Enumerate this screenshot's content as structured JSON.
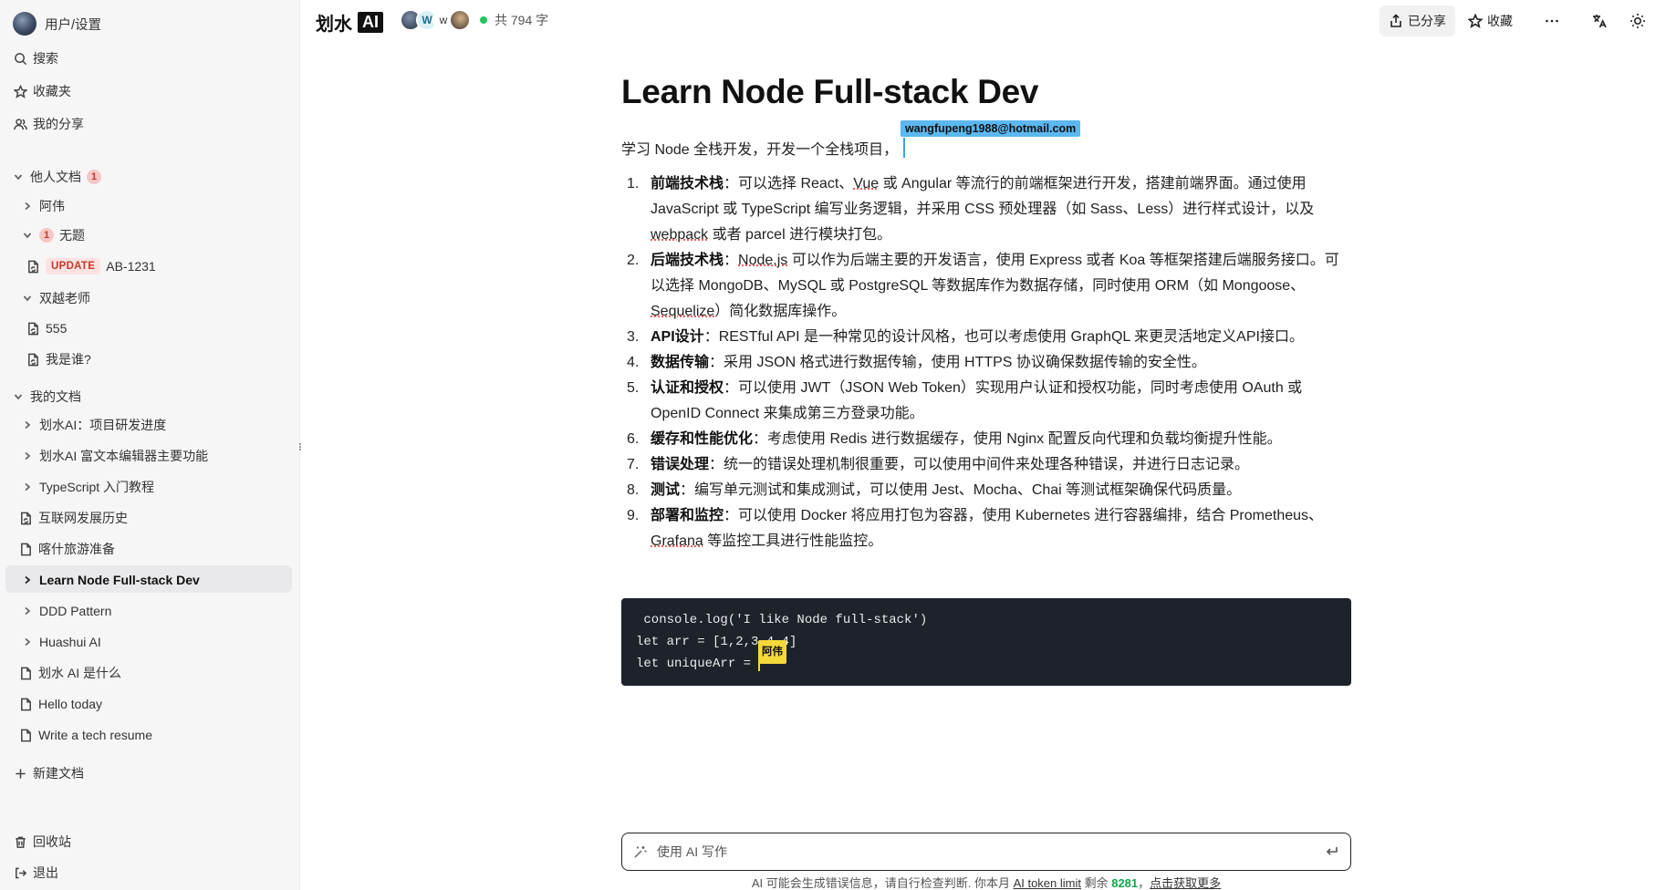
{
  "sidebar": {
    "user_label": "用户/设置",
    "search": "搜索",
    "favorites": "收藏夹",
    "my_shares": "我的分享",
    "others_docs": {
      "title": "他人文档",
      "badge": "1"
    },
    "others_items": {
      "awei": "阿伟",
      "untitled": {
        "badge": "1",
        "label": "无题"
      },
      "update_doc": {
        "tag": "UPDATE",
        "label": "AB-1231"
      },
      "teacher": "双越老师",
      "doc555": "555",
      "whoami": "我是谁?"
    },
    "my_docs": {
      "title": "我的文档"
    },
    "my_items": {
      "i1": "划水AI：项目研发进度",
      "i2": "划水AI 富文本编辑器主要功能",
      "i3": "TypeScript 入门教程",
      "i4": "互联网发展历史",
      "i5": "喀什旅游准备",
      "i6": "Learn Node Full-stack Dev",
      "i7": "DDD Pattern",
      "i8": "Huashui AI",
      "i9": "划水 AI 是什么",
      "i10": "Hello today",
      "i11": "Write a tech resume"
    },
    "new_doc": "新建文档",
    "trash": "回收站",
    "logout": "退出"
  },
  "header": {
    "brand": "划水",
    "brand_ai": "AI",
    "collab_letter_a2": "W",
    "collab_letter_a3": "w",
    "word_count": "共 794 字",
    "shared_label": "已分享",
    "favorite_label": "收藏"
  },
  "doc": {
    "title": "Learn Node Full-stack Dev",
    "intro": "学习 Node 全栈开发，开发一个全栈项目，",
    "cursor_user": "wangfupeng1988@hotmail.com",
    "items": {
      "n1": "1.",
      "n2": "2.",
      "n3": "3.",
      "n4": "4.",
      "n5": "5.",
      "n6": "6.",
      "n7": "7.",
      "n8": "8.",
      "n9": "9.",
      "b1": "前端技术栈",
      "t1a": "：可以选择 React、",
      "t1b": "Vue",
      "t1c": " 或 Angular 等流行的前端框架进行开发，搭建前端界面。通过使用 JavaScript 或 TypeScript 编写业务逻辑，并采用 CSS 预处理器（如 Sass、Less）进行样式设计，以及 ",
      "t1d": "webpack",
      "t1e": " 或者 parcel 进行模块打包。",
      "b2": "后端技术栈",
      "t2a": "：",
      "t2b": "Node.js",
      "t2c": " 可以作为后端主要的开发语言，使用 Express 或者 Koa 等框架搭建后端服务接口。可以选择 MongoDB、MySQL 或 PostgreSQL 等数据库作为数据存储，同时使用 ORM（如 Mongoose、",
      "t2d": "Sequelize",
      "t2e": "）简化数据库操作。",
      "b3": "API设计",
      "t3": "：RESTful API 是一种常见的设计风格，也可以考虑使用 GraphQL 来更灵活地定义API接口。",
      "b4": "数据传输",
      "t4": "：采用 JSON 格式进行数据传输，使用 HTTPS 协议确保数据传输的安全性。",
      "b5": "认证和授权",
      "t5": "：可以使用 JWT（JSON Web Token）实现用户认证和授权功能，同时考虑使用 OAuth 或 OpenID Connect 来集成第三方登录功能。",
      "b6": "缓存和性能优化",
      "t6": "：考虑使用 Redis 进行数据缓存，使用 Nginx 配置反向代理和负载均衡提升性能。",
      "b7": "错误处理",
      "t7": "：统一的错误处理机制很重要，可以使用中间件来处理各种错误，并进行日志记录。",
      "b8": "测试",
      "t8": "：编写单元测试和集成测试，可以使用 Jest、Mocha、Chai 等测试框架确保代码质量。",
      "b9": "部署和监控",
      "t9a": "：可以使用 Docker 将应用打包为容器，使用 Kubernetes 进行容器编排，结合 Prometheus、",
      "t9b": "Grafana",
      "t9c": " 等监控工具进行性能监控。"
    },
    "code": {
      "line1": " console.log('I like Node full-stack')",
      "line2": "let arr = [1,2,3,4,4]",
      "line3": "let uniqueArr = ",
      "cursor_user": "阿伟"
    }
  },
  "ai": {
    "placeholder": "使用 AI 写作",
    "note_prefix": "AI 可能会生成错误信息，请自行检查判断. 你本月 ",
    "note_link": "AI token limit",
    "note_mid": " 剩余 ",
    "note_remaining": "8281",
    "note_sep": "，",
    "note_more": "点击获取更多"
  }
}
